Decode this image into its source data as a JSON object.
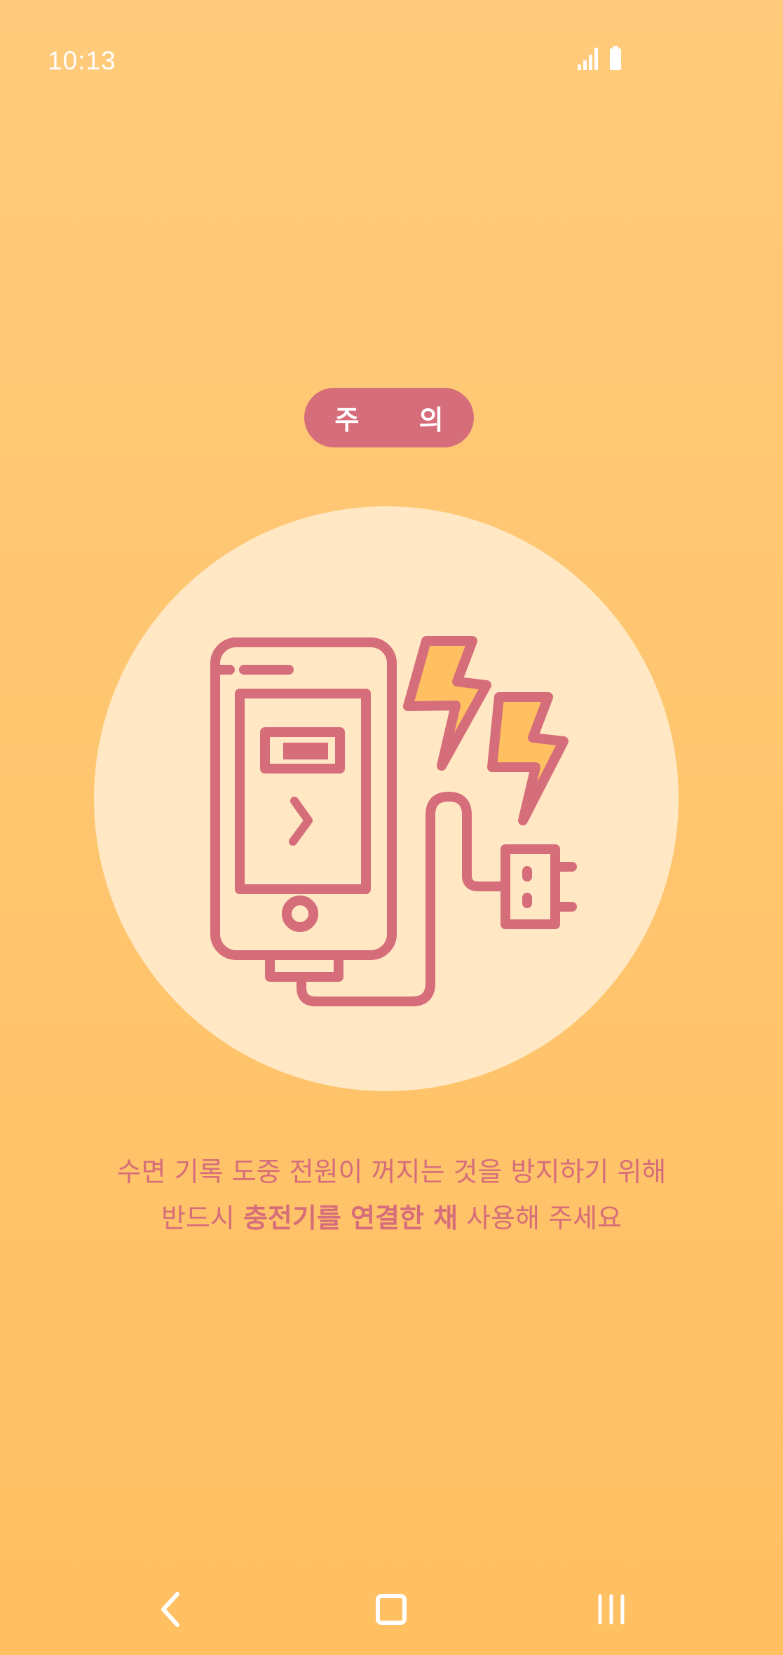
{
  "status_bar": {
    "time": "10:13",
    "signal_icon": "signal-bars-icon",
    "battery_icon": "battery-full-icon"
  },
  "warning": {
    "label": "주 의"
  },
  "illustration": {
    "icon": "phone-charging-icon"
  },
  "message": {
    "line1": "수면 기록 도중 전원이 꺼지는 것을 방지하기 위해",
    "line2_prefix": "반드시 ",
    "line2_emphasis": "충전기를 연결한 채",
    "line2_suffix": " 사용해 주세요"
  },
  "nav": {
    "back_icon": "back-chevron-icon",
    "home_icon": "home-square-icon",
    "recents_icon": "recents-bars-icon"
  },
  "colors": {
    "background_top": "#FFCA7B",
    "background_bottom": "#FFC062",
    "accent": "#D66D7A",
    "circle": "#FFE8C3",
    "bolt": "#FFC062"
  }
}
